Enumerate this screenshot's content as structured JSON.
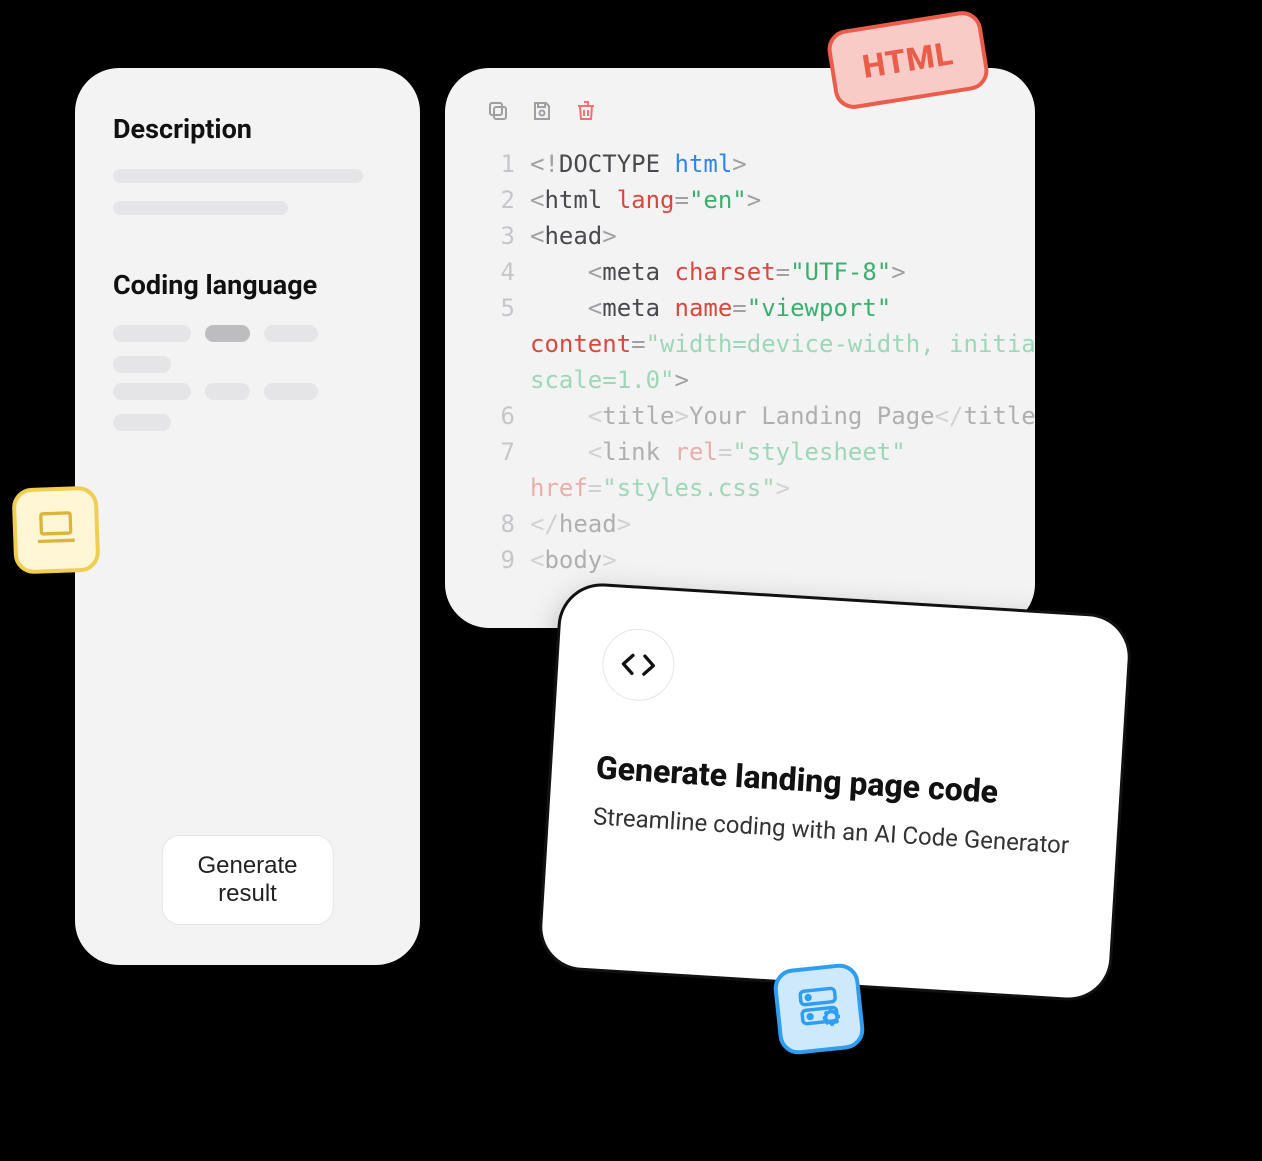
{
  "left_panel": {
    "description_heading": "Description",
    "coding_language_heading": "Coding language",
    "generate_button": "Generate result"
  },
  "badges": {
    "html_label": "HTML",
    "laptop_icon": "laptop",
    "server_icon": "server-gear"
  },
  "code_panel": {
    "lines": [
      {
        "n": "1",
        "html": "<span class='tok-punc'>&lt;!</span><span class='tok-tag'>DOCTYPE </span><span class='tok-kw'>html</span><span class='tok-punc'>&gt;</span>"
      },
      {
        "n": "2",
        "html": "<span class='tok-punc'>&lt;</span><span class='tok-tag'>html </span><span class='tok-attr'>lang</span><span class='tok-punc'>=</span><span class='tok-str'>\"en\"</span><span class='tok-punc'>&gt;</span>"
      },
      {
        "n": "3",
        "html": "<span class='tok-punc'>&lt;</span><span class='tok-tag'>head</span><span class='tok-punc'>&gt;</span>"
      },
      {
        "n": "4",
        "html": "    <span class='tok-punc'>&lt;</span><span class='tok-tag'>meta </span><span class='tok-attr'>charset</span><span class='tok-punc'>=</span><span class='tok-str'>\"UTF-8\"</span><span class='tok-punc'>&gt;</span>"
      },
      {
        "n": "5",
        "html": "    <span class='tok-punc'>&lt;</span><span class='tok-tag'>meta </span><span class='tok-attr'>name</span><span class='tok-punc'>=</span><span class='tok-str'>\"viewport\"</span>"
      },
      {
        "n": "",
        "html": "<span class='tok-attr'>content</span><span class='tok-punc'>=</span><span class='tok-strlt'>\"width=device-width, initial-</span>"
      },
      {
        "n": "",
        "html": "<span class='tok-strlt'>scale=1.0\"</span><span class='tok-punc'>&gt;</span>"
      },
      {
        "n": "6",
        "html": "    <span class='tok-punc faded'>&lt;</span><span class='tok-tag faded'>title</span><span class='tok-punc faded'>&gt;</span><span class='tok-tag faded'>Your Landing Page</span><span class='tok-punc faded'>&lt;/</span><span class='tok-tag faded'>title</span><span class='tok-punc faded'>&gt;</span>"
      },
      {
        "n": "7",
        "html": "    <span class='tok-punc faded'>&lt;</span><span class='tok-tag faded'>link </span><span class='tok-attr faded'>rel</span><span class='tok-punc faded'>=</span><span class='tok-strlt'>\"stylesheet\"</span>"
      },
      {
        "n": "",
        "html": "<span class='tok-attr faded'>href</span><span class='tok-punc faded'>=</span><span class='tok-strlt'>\"styles.css\"</span><span class='tok-punc faded'>&gt;</span>"
      },
      {
        "n": "8",
        "html": "<span class='tok-punc faded'>&lt;/</span><span class='tok-tag faded'>head</span><span class='tok-punc faded'>&gt;</span>"
      },
      {
        "n": "9",
        "html": "<span class='tok-punc faded'>&lt;</span><span class='tok-tag faded'>body</span><span class='tok-punc faded'>&gt;</span>"
      }
    ]
  },
  "promo": {
    "title": "Generate landing page code",
    "subtitle": "Streamline coding with an AI Code Generator"
  }
}
